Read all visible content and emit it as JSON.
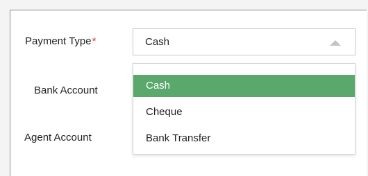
{
  "form": {
    "payment_type_label": "Payment Type",
    "required_marker": "*",
    "bank_account_label": "Bank Account",
    "agent_account_label": "Agent Account"
  },
  "payment_type_select": {
    "selected_value": "Cash",
    "arrow_icon": "caret-up-icon"
  },
  "dropdown": {
    "options": [
      {
        "label": "Cash",
        "highlighted": true
      },
      {
        "label": "Cheque",
        "highlighted": false
      },
      {
        "label": "Bank Transfer",
        "highlighted": false
      }
    ]
  },
  "colors": {
    "highlight": "#5aa86c",
    "required": "#e23b3b"
  }
}
